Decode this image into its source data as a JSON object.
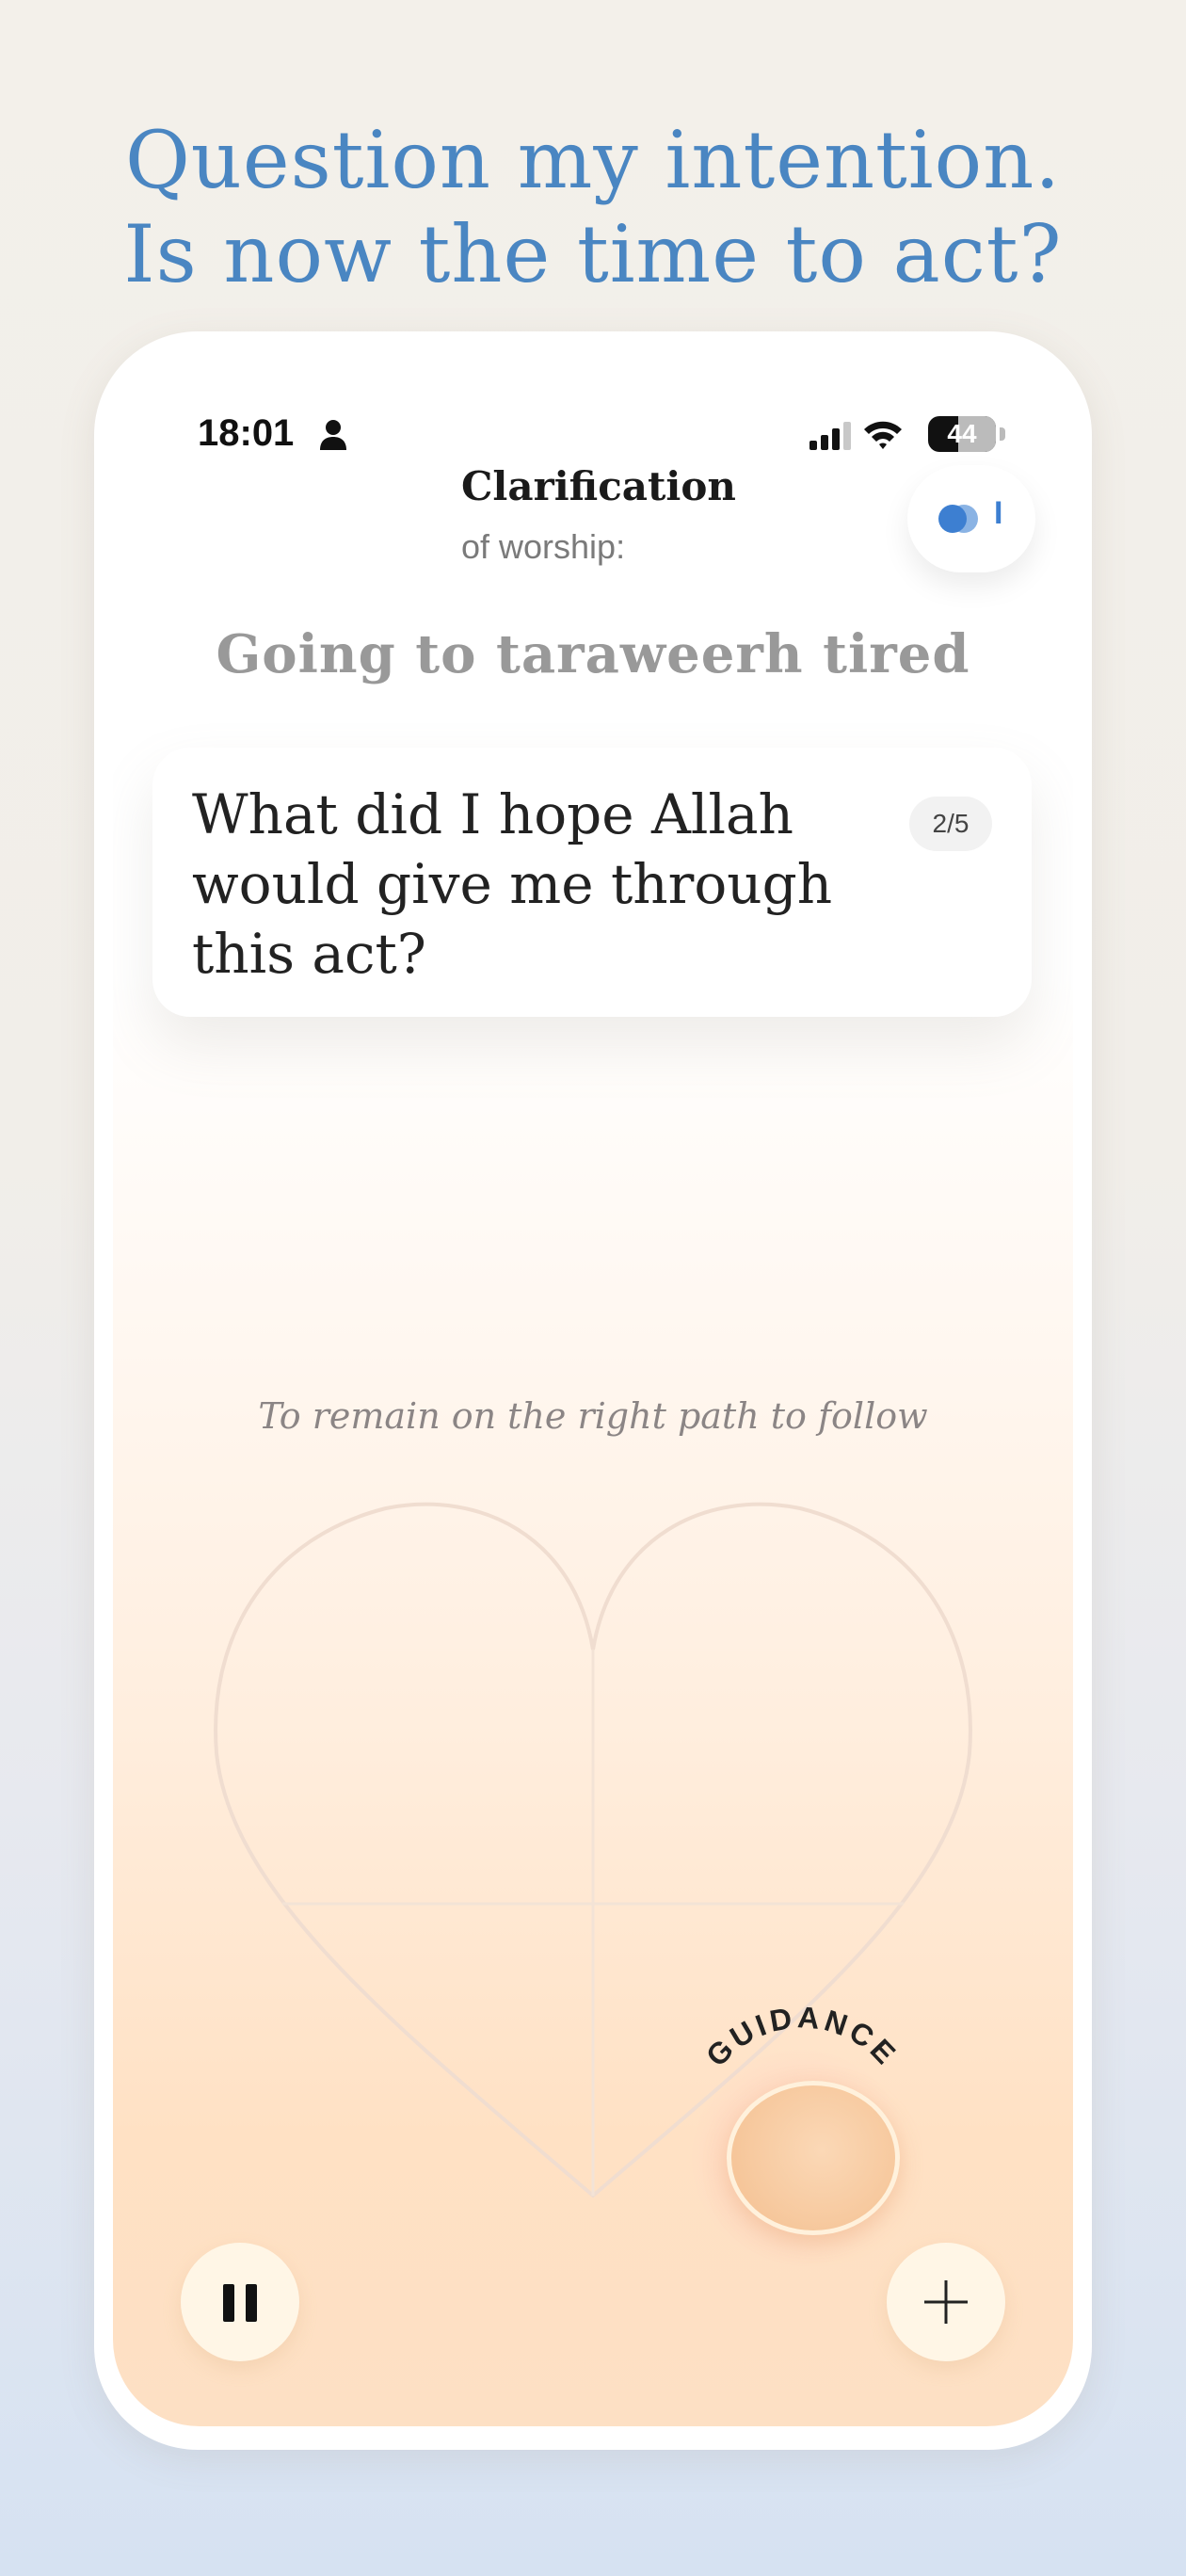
{
  "promo": {
    "line1": "Question my intention.",
    "line2": "Is now the time to act?"
  },
  "status_bar": {
    "time": "18:01",
    "battery_level": "44",
    "battery_fraction": 0.44,
    "icons": [
      "person-icon",
      "cellular-signal-icon",
      "wifi-icon",
      "battery-icon"
    ]
  },
  "header": {
    "title": "Clarification",
    "subtitle": "of worship:",
    "toggle_count": "I",
    "accent_color": "#3d7fd1"
  },
  "worship": {
    "title": "Going to taraweerh tired"
  },
  "question_card": {
    "text": "What did I hope Allah would give me through this act?",
    "progress": "2/5",
    "current": 2,
    "total": 5
  },
  "hint": "To remain on the right path to follow",
  "guidance": {
    "label": "GUIDANCE"
  },
  "controls": {
    "pause_icon": "pause-icon",
    "add_icon": "plus-icon"
  },
  "colors": {
    "promo_heading": "#4a86c2",
    "orb": "#f7caa0"
  }
}
